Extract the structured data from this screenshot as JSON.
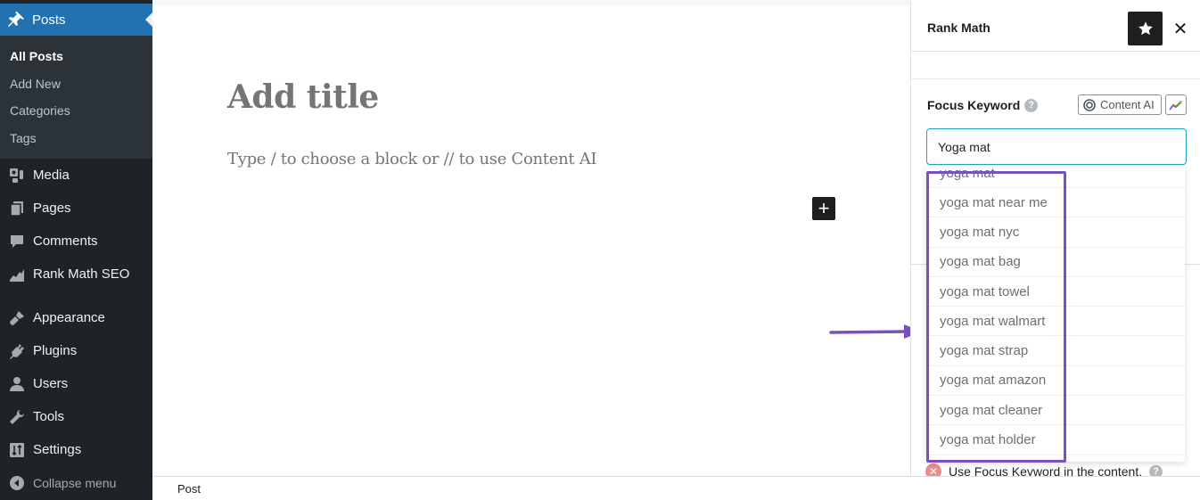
{
  "sidebar": {
    "active_section": {
      "label": "Posts",
      "icon": "pin-icon"
    },
    "submenu": [
      {
        "label": "All Posts",
        "current": true
      },
      {
        "label": "Add New",
        "current": false
      },
      {
        "label": "Categories",
        "current": false
      },
      {
        "label": "Tags",
        "current": false
      }
    ],
    "items": [
      {
        "label": "Media",
        "icon": "media-icon"
      },
      {
        "label": "Pages",
        "icon": "pages-icon"
      },
      {
        "label": "Comments",
        "icon": "comments-icon"
      },
      {
        "label": "Rank Math SEO",
        "icon": "rank-math-icon"
      },
      {
        "label": "Appearance",
        "icon": "brush-icon"
      },
      {
        "label": "Plugins",
        "icon": "plugin-icon"
      },
      {
        "label": "Users",
        "icon": "user-icon"
      },
      {
        "label": "Tools",
        "icon": "wrench-icon"
      },
      {
        "label": "Settings",
        "icon": "settings-icon"
      }
    ],
    "collapse_label": "Collapse menu"
  },
  "editor": {
    "title_placeholder": "Add title",
    "block_placeholder": "Type / to choose a block or // to use Content AI",
    "add_block_label": "+"
  },
  "footer": {
    "breadcrumb": "Post"
  },
  "panel": {
    "title": "Rank Math",
    "close_label": "✕",
    "focus_keyword_label": "Focus Keyword",
    "help_label": "?",
    "content_ai_label": "Content AI",
    "focus_keyword_value": "Yoga mat",
    "check_text": "Use Focus Keyword in the content.",
    "suggestions": [
      "yoga mat",
      "yoga mat near me",
      "yoga mat nyc",
      "yoga mat bag",
      "yoga mat towel",
      "yoga mat walmart",
      "yoga mat strap",
      "yoga mat amazon",
      "yoga mat cleaner",
      "yoga mat holder"
    ]
  },
  "annotations": {
    "highlight_color": "#7a4fc0",
    "arrow_color": "#7a4fc0"
  },
  "colors": {
    "sidebar_bg": "#1d2327",
    "sidebar_active": "#2271b1",
    "input_focus": "#1ea4c8"
  }
}
